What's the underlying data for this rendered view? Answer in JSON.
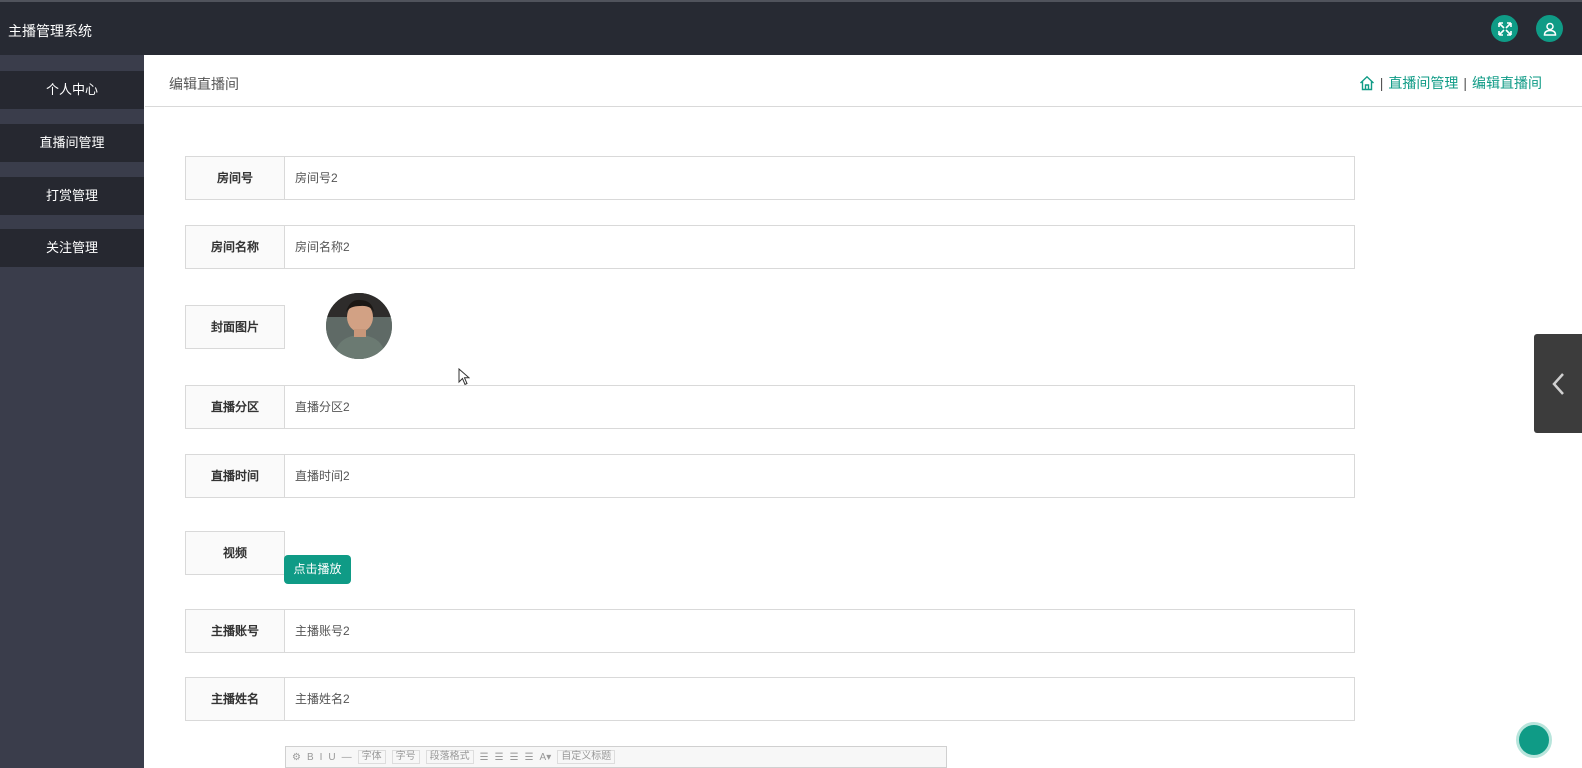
{
  "app": {
    "title": "主播管理系统"
  },
  "topbar": {
    "fullscreen_icon": "fullscreen-icon",
    "user_icon": "user-icon"
  },
  "sidebar": {
    "items": [
      {
        "label": "个人中心"
      },
      {
        "label": "直播间管理"
      },
      {
        "label": "打赏管理"
      },
      {
        "label": "关注管理"
      }
    ]
  },
  "header": {
    "title": "编辑直播间",
    "breadcrumb": {
      "home_icon": "home-icon",
      "items": [
        "直播间管理",
        "编辑直播间"
      ],
      "separator": "|"
    }
  },
  "form": {
    "room_no": {
      "label": "房间号",
      "value": "房间号2"
    },
    "room_name": {
      "label": "房间名称",
      "value": "房间名称2"
    },
    "cover": {
      "label": "封面图片"
    },
    "category": {
      "label": "直播分区",
      "value": "直播分区2"
    },
    "live_time": {
      "label": "直播时间",
      "value": "直播时间2"
    },
    "video": {
      "label": "视频",
      "play_label": "点击播放"
    },
    "anchor_account": {
      "label": "主播账号",
      "value": "主播账号2"
    },
    "anchor_name": {
      "label": "主播姓名",
      "value": "主播姓名2"
    }
  },
  "editor": {
    "buttons": [
      "B",
      "I",
      "U"
    ],
    "font_family": "字体",
    "font_size": "字号",
    "paragraph": "段落格式",
    "custom_title": "自定义标题"
  },
  "colors": {
    "accent": "#0f9b86",
    "topbar": "#272a33",
    "sidebar": "#3a3d4b",
    "sidebar_item": "#262830"
  }
}
